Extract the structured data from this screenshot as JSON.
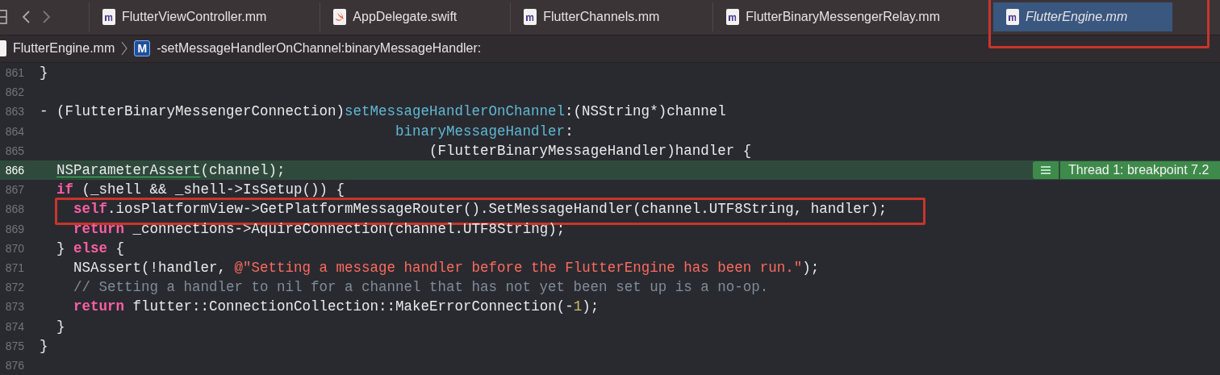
{
  "tabs": [
    {
      "label": "FlutterViewController.mm",
      "kind": "objc",
      "selected": false,
      "highlighted": false
    },
    {
      "label": "AppDelegate.swift",
      "kind": "swift",
      "selected": false,
      "highlighted": false
    },
    {
      "label": "FlutterChannels.mm",
      "kind": "objc",
      "selected": false,
      "highlighted": false
    },
    {
      "label": "FlutterBinaryMessengerRelay.mm",
      "kind": "objc",
      "selected": false,
      "highlighted": false
    },
    {
      "label": "FlutterEngine.mm",
      "kind": "objc",
      "selected": true,
      "highlighted": true
    }
  ],
  "breadcrumb": {
    "file": "FlutterEngine.mm",
    "symbol_badge": "M",
    "symbol": "-setMessageHandlerOnChannel:binaryMessageHandler:"
  },
  "lines": [
    {
      "number": "861",
      "breakpoint": false,
      "highlighted": false,
      "tokens": [
        {
          "kind": "plain",
          "text": "}"
        }
      ]
    },
    {
      "number": "862",
      "breakpoint": false,
      "highlighted": false
    },
    {
      "number": "863",
      "breakpoint": false,
      "highlighted": false,
      "tokens": [
        {
          "kind": "plain",
          "text": "- (FlutterBinaryMessengerConnection)"
        },
        {
          "kind": "method",
          "text": "setMessageHandlerOnChannel"
        },
        {
          "kind": "plain",
          "text": ":(NSString*)channel"
        }
      ]
    },
    {
      "number": "864",
      "breakpoint": false,
      "highlighted": false,
      "tokens": [
        {
          "kind": "method",
          "text": "                                          binaryMessageHandler"
        },
        {
          "kind": "plain",
          "text": ":"
        }
      ]
    },
    {
      "number": "865",
      "breakpoint": false,
      "highlighted": false,
      "tokens": [
        {
          "kind": "plain",
          "text": "                                              (FlutterBinaryMessageHandler)handler {"
        }
      ]
    },
    {
      "number": "866",
      "breakpoint": true,
      "highlighted": false,
      "tokens": [
        {
          "kind": "underlined",
          "text": "  NSParameterAssert"
        },
        {
          "kind": "plain",
          "text": "(channel);"
        }
      ]
    },
    {
      "number": "867",
      "breakpoint": false,
      "highlighted": false,
      "tokens": [
        {
          "kind": "keyword",
          "text": "  if"
        },
        {
          "kind": "plain",
          "text": " (_shell && _shell->IsSetup()) {"
        }
      ]
    },
    {
      "number": "868",
      "breakpoint": false,
      "highlighted": true,
      "tokens": [
        {
          "kind": "keyword",
          "text": "    self"
        },
        {
          "kind": "plain",
          "text": ".iosPlatformView->GetPlatformMessageRouter().SetMessageHandler(channel.UTF8String, handler);"
        }
      ]
    },
    {
      "number": "869",
      "breakpoint": false,
      "highlighted": false,
      "tokens": [
        {
          "kind": "keyword",
          "text": "    return"
        },
        {
          "kind": "plain",
          "text": " _connections->AquireConnection(channel.UTF8String);"
        }
      ]
    },
    {
      "number": "870",
      "breakpoint": false,
      "highlighted": false,
      "tokens": [
        {
          "kind": "plain",
          "text": "  } "
        },
        {
          "kind": "keyword",
          "text": "else"
        },
        {
          "kind": "plain",
          "text": " {"
        }
      ]
    },
    {
      "number": "871",
      "breakpoint": false,
      "highlighted": false,
      "tokens": [
        {
          "kind": "plain",
          "text": "    NSAssert(!handler, "
        },
        {
          "kind": "string",
          "text": "@\"Setting a message handler before the FlutterEngine has been run.\""
        },
        {
          "kind": "plain",
          "text": ");"
        }
      ]
    },
    {
      "number": "872",
      "breakpoint": false,
      "highlighted": false,
      "tokens": [
        {
          "kind": "comment",
          "text": "    // Setting a handler to nil for a channel that has not yet been set up is a no-op."
        }
      ]
    },
    {
      "number": "873",
      "breakpoint": false,
      "highlighted": false,
      "tokens": [
        {
          "kind": "keyword",
          "text": "    return"
        },
        {
          "kind": "plain",
          "text": " flutter::ConnectionCollection::MakeErrorConnection(-"
        },
        {
          "kind": "number",
          "text": "1"
        },
        {
          "kind": "plain",
          "text": ");"
        }
      ]
    },
    {
      "number": "874",
      "breakpoint": false,
      "highlighted": false,
      "tokens": [
        {
          "kind": "plain",
          "text": "  }"
        }
      ]
    },
    {
      "number": "875",
      "breakpoint": false,
      "highlighted": false,
      "tokens": [
        {
          "kind": "plain",
          "text": "}"
        }
      ]
    },
    {
      "number": "876",
      "breakpoint": false,
      "highlighted": false
    }
  ],
  "breakpoint_label": "Thread 1: breakpoint 7.2"
}
